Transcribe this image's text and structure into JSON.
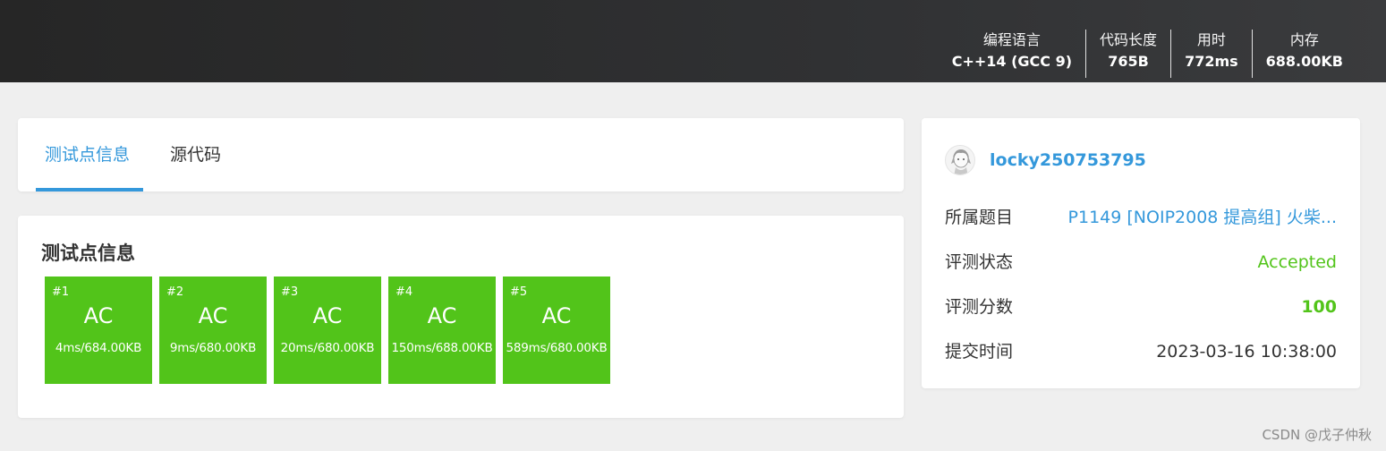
{
  "header": {
    "stats": [
      {
        "label": "编程语言",
        "value": "C++14 (GCC 9)"
      },
      {
        "label": "代码长度",
        "value": "765B"
      },
      {
        "label": "用时",
        "value": "772ms"
      },
      {
        "label": "内存",
        "value": "688.00KB"
      }
    ]
  },
  "tabs": [
    {
      "label": "测试点信息",
      "active": true
    },
    {
      "label": "源代码",
      "active": false
    }
  ],
  "cases_section": {
    "title": "测试点信息",
    "cases": [
      {
        "num": "#1",
        "status": "AC",
        "detail": "4ms/684.00KB"
      },
      {
        "num": "#2",
        "status": "AC",
        "detail": "9ms/680.00KB"
      },
      {
        "num": "#3",
        "status": "AC",
        "detail": "20ms/680.00KB"
      },
      {
        "num": "#4",
        "status": "AC",
        "detail": "150ms/688.00KB"
      },
      {
        "num": "#5",
        "status": "AC",
        "detail": "589ms/680.00KB"
      }
    ]
  },
  "info": {
    "username": "locky250753795",
    "rows": [
      {
        "label": "所属题目",
        "value": "P1149 [NOIP2008 提高组] 火柴..."
      },
      {
        "label": "评测状态",
        "value": "Accepted"
      },
      {
        "label": "评测分数",
        "value": "100"
      },
      {
        "label": "提交时间",
        "value": "2023-03-16 10:38:00"
      }
    ]
  },
  "watermark": "CSDN @戊子仲秋",
  "colors": {
    "accent": "#3498db",
    "ac_green": "#52c41a",
    "header_bg": "#2b2b2c",
    "page_bg": "#efefef"
  }
}
